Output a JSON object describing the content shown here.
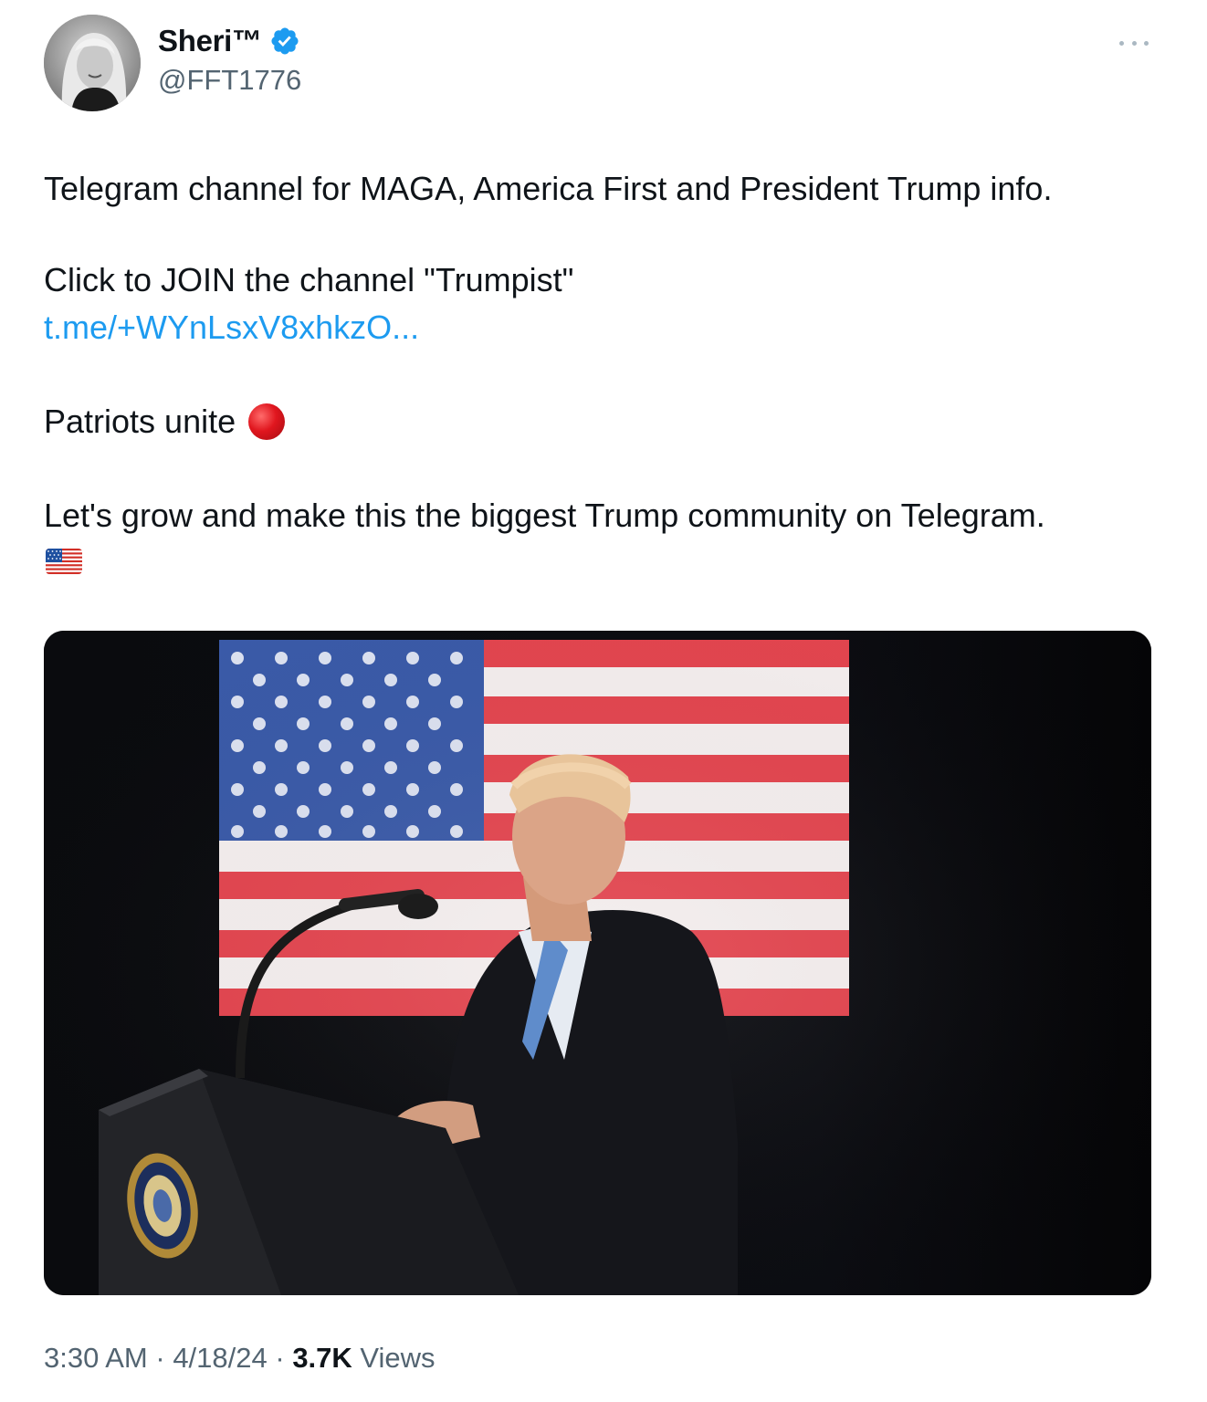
{
  "author": {
    "display_name": "Sheri™",
    "handle": "@FFT1776",
    "verified": true,
    "avatar_icon": "woman-profile-photo"
  },
  "tweet": {
    "line1": "Telegram channel for MAGA, America First and President Trump info.",
    "line2": "Click to JOIN the channel \"Trumpist\"",
    "link": "t.me/+WYnLsxV8xhkzO...",
    "line3": "Patriots unite",
    "line3_emoji": "red-circle-emoji",
    "line4": "Let's grow and make this the biggest Trump community on Telegram.",
    "line4_emoji": "us-flag-emoji"
  },
  "media": {
    "icon": "photo-speaker-at-podium-before-american-flag"
  },
  "meta": {
    "time": "3:30 AM",
    "sep1": " · ",
    "date": "4/18/24",
    "sep2": " · ",
    "views_count": "3.7K",
    "views_label": " Views"
  },
  "colors": {
    "link": "#1d9bf0",
    "secondary_text": "#536471",
    "verified_badge": "#1d9bf0"
  }
}
